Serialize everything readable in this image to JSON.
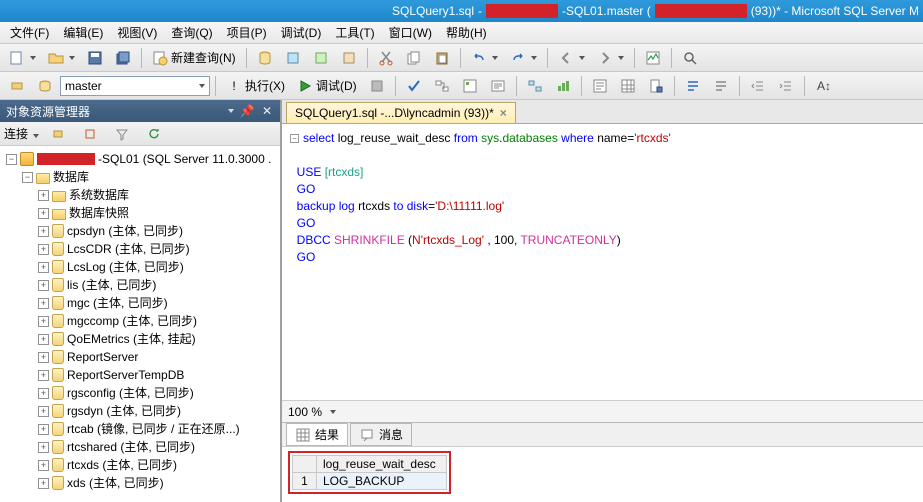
{
  "title": {
    "file": "SQLQuery1.sql",
    "sep1": " - ",
    "server_suffix": "-SQL01.master (",
    "spid_suffix": " (93))* - Microsoft SQL Server M"
  },
  "menu": [
    "文件(F)",
    "编辑(E)",
    "视图(V)",
    "查询(Q)",
    "项目(P)",
    "调试(D)",
    "工具(T)",
    "窗口(W)",
    "帮助(H)"
  ],
  "toolbar1": {
    "newquery": "新建查询(N)"
  },
  "toolbar2": {
    "db": "master",
    "execute": "执行(X)",
    "debug": "调试(D)"
  },
  "object_explorer": {
    "title": "对象资源管理器",
    "connect": "连接"
  },
  "tree": {
    "root_suffix": "-SQL01 (SQL Server 11.0.3000 .",
    "db_folder": "数据库",
    "sys_db": "系统数据库",
    "snapshot": "数据库快照",
    "items": [
      "cpsdyn (主体, 已同步)",
      "LcsCDR (主体, 已同步)",
      "LcsLog (主体, 已同步)",
      "lis (主体, 已同步)",
      "mgc (主体, 已同步)",
      "mgccomp (主体, 已同步)",
      "QoEMetrics (主体, 挂起)",
      "ReportServer",
      "ReportServerTempDB",
      "rgsconfig (主体, 已同步)",
      "rgsdyn (主体, 已同步)",
      "rtcab (镜像, 已同步 / 正在还原...)",
      "rtcshared (主体, 已同步)",
      "rtcxds (主体, 已同步)",
      "xds (主体, 已同步)"
    ]
  },
  "doc_tab": "SQLQuery1.sql -...D\\lyncadmin (93))*",
  "sql": {
    "l1": {
      "a": "select ",
      "b": "log_reuse_wait_desc ",
      "c": "from ",
      "d": "sys",
      "e": ".",
      "f": "databases ",
      "g": "where ",
      "h": "name",
      "i": "=",
      "j": "'rtcxds'"
    },
    "l3": {
      "a": "USE ",
      "b": "[rtcxds]"
    },
    "l4": "GO",
    "l5": {
      "a": "backup ",
      "b": "log ",
      "c": "rtcxds ",
      "d": "to ",
      "e": "disk",
      "f": "=",
      "g": "'D:\\11111.log'"
    },
    "l6": "GO",
    "l7": {
      "a": "DBCC ",
      "b": "SHRINKFILE ",
      "c": "(",
      "d": "N'rtcxds_Log'",
      "e": " , 100, ",
      "f": "TRUNCATEONLY",
      "g": ")"
    },
    "l8": "GO"
  },
  "zoom": "100 %",
  "results": {
    "tab1": "结果",
    "tab2": "消息",
    "col1": "log_reuse_wait_desc",
    "row1": "1",
    "val1": "LOG_BACKUP"
  }
}
